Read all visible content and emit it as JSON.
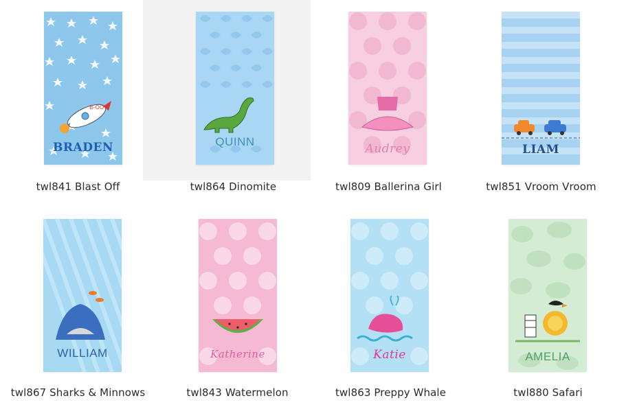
{
  "products": [
    {
      "sku_title": "twl841 Blast Off",
      "name": "BRADEN",
      "bg": "#8ec7ec",
      "pattern": "stars",
      "name_color": "#1d5fb4",
      "motif": "rocket-icon"
    },
    {
      "sku_title": "twl864 Dinomite",
      "name": "QUINN",
      "bg": "#a9d6f2",
      "pattern": "dino-scales",
      "name_color": "#3f8fbf",
      "motif": "dinosaur-icon"
    },
    {
      "sku_title": "twl809 Ballerina Girl",
      "name": "Audrey",
      "bg": "#f7cfe0",
      "pattern": "dots",
      "name_color": "#e07fae",
      "motif": "tutu-icon"
    },
    {
      "sku_title": "twl851 Vroom Vroom",
      "name": "LIAM",
      "bg": "#a8d2f2",
      "pattern": "stripes",
      "name_color": "#1f4f8f",
      "motif": "cars-icon"
    },
    {
      "sku_title": "twl867 Sharks & Minnows",
      "name": "WILLIAM",
      "bg": "#a7d9f3",
      "pattern": "diagonal",
      "name_color": "#2d63a9",
      "motif": "shark-icon"
    },
    {
      "sku_title": "twl843 Watermelon",
      "name": "Katherine",
      "bg": "#f6b9d3",
      "pattern": "dots",
      "name_color": "#e05fa0",
      "motif": "watermelon-icon"
    },
    {
      "sku_title": "twl863 Preppy Whale",
      "name": "Katie",
      "bg": "#b3e0f4",
      "pattern": "dots",
      "name_color": "#dd3c8e",
      "motif": "whale-icon"
    },
    {
      "sku_title": "twl880 Safari",
      "name": "AMELIA",
      "bg": "#d3ecd3",
      "pattern": "leaves",
      "name_color": "#4fa063",
      "motif": "safari-icon"
    }
  ]
}
